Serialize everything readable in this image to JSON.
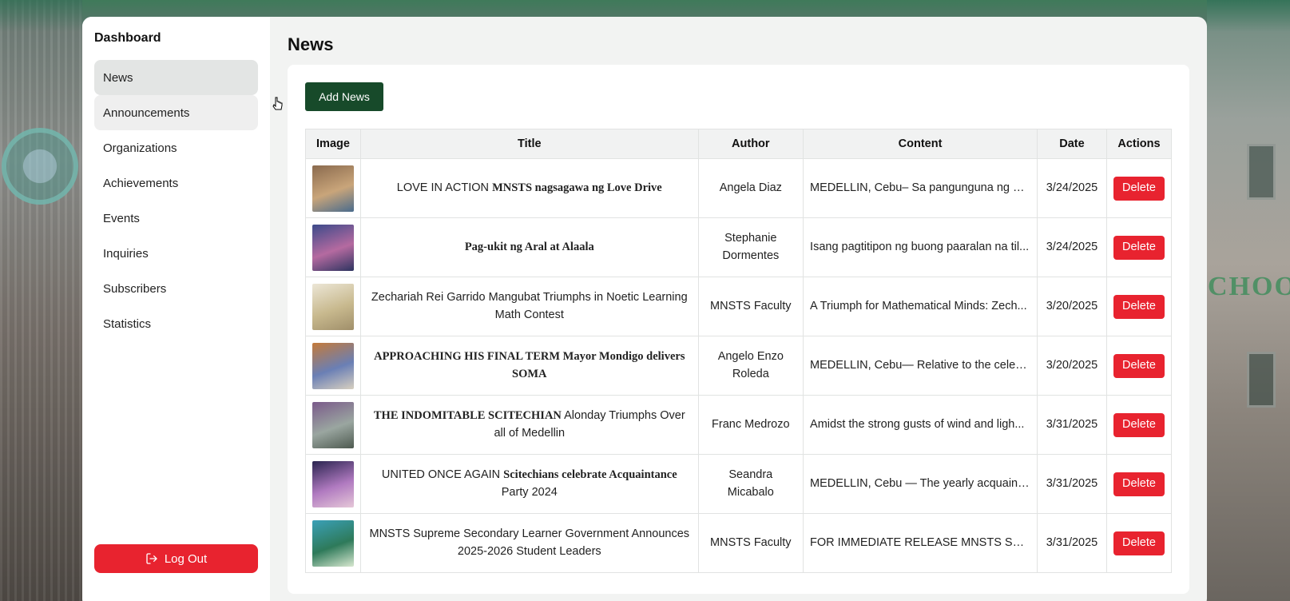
{
  "sidebar": {
    "title": "Dashboard",
    "items": [
      {
        "label": "News",
        "state": "active"
      },
      {
        "label": "Announcements",
        "state": "hover"
      },
      {
        "label": "Organizations",
        "state": ""
      },
      {
        "label": "Achievements",
        "state": ""
      },
      {
        "label": "Events",
        "state": ""
      },
      {
        "label": "Inquiries",
        "state": ""
      },
      {
        "label": "Subscribers",
        "state": ""
      },
      {
        "label": "Statistics",
        "state": ""
      }
    ],
    "logout_label": "Log Out",
    "logout_icon": "logout-icon"
  },
  "main": {
    "title": "News",
    "add_button_label": "Add News",
    "table": {
      "headers": [
        "Image",
        "Title",
        "Author",
        "Content",
        "Date",
        "Actions"
      ],
      "delete_label": "Delete",
      "rows": [
        {
          "title_plain": "LOVE IN ACTION",
          "title_serif": "MNSTS nagsagawa ng Love Drive",
          "title_plain_after": "",
          "author": "Angela Diaz",
          "content": "MEDELLIN, Cebu– Sa pangunguna ng Su...",
          "date": "3/24/2025",
          "thumb_colors": [
            "#8a6a4e",
            "#c9a57a",
            "#4a6b8c"
          ]
        },
        {
          "title_plain": "",
          "title_serif": "Pag-ukit ng Aral at Alaala",
          "title_plain_after": "",
          "author": "Stephanie Dormentes",
          "content": "Isang pagtitipon ng buong paaralan na til...",
          "date": "3/24/2025",
          "thumb_colors": [
            "#3c4a8a",
            "#b56aa0",
            "#2e3460"
          ]
        },
        {
          "title_plain": "Zechariah Rei Garrido Mangubat Triumphs in Noetic Learning Math Contest",
          "title_serif": "",
          "title_plain_after": "",
          "author": "MNSTS Faculty",
          "content": "A Triumph for Mathematical Minds: Zech...",
          "date": "3/20/2025",
          "thumb_colors": [
            "#ece6d6",
            "#c8b98e",
            "#a08f6a"
          ]
        },
        {
          "title_plain": "",
          "title_serif": "APPROACHING HIS FINAL TERM Mayor Mondigo delivers SOMA",
          "title_plain_after": "",
          "author": "Angelo Enzo Roleda",
          "content": "MEDELLIN, Cebu— Relative to the celeb...",
          "date": "3/20/2025",
          "thumb_colors": [
            "#c47a3a",
            "#6a7fb5",
            "#d8d0c0"
          ]
        },
        {
          "title_plain": "",
          "title_serif": "THE INDOMITABLE SCITECHIAN",
          "title_plain_after": "Alonday Triumphs Over all of Medellin",
          "author": "Franc Medrozo",
          "content": "Amidst the strong gusts of wind and ligh...",
          "date": "3/31/2025",
          "thumb_colors": [
            "#7a5a8a",
            "#9aa6a0",
            "#4e5a50"
          ]
        },
        {
          "title_plain": "UNITED ONCE AGAIN",
          "title_serif": "Scitechians celebrate Acquaintance",
          "title_plain_after": "Party 2024",
          "author": "Seandra Micabalo",
          "content": "MEDELLIN, Cebu — The yearly acquaint...",
          "date": "3/31/2025",
          "thumb_colors": [
            "#2a2450",
            "#b07ac0",
            "#e6c8d8"
          ]
        },
        {
          "title_plain": "MNSTS Supreme Secondary Learner Government Announces 2025-2026 Student Leaders",
          "title_serif": "",
          "title_plain_after": "",
          "author": "MNSTS Faculty",
          "content": "FOR IMMEDIATE RELEASE MNSTS Supr...",
          "date": "3/31/2025",
          "thumb_colors": [
            "#3aa0b8",
            "#2e7a5a",
            "#d8e8d0"
          ]
        }
      ]
    }
  },
  "colors": {
    "primary_green": "#174a2a",
    "danger_red": "#e8232f",
    "active_nav_bg": "#e3e5e4"
  }
}
